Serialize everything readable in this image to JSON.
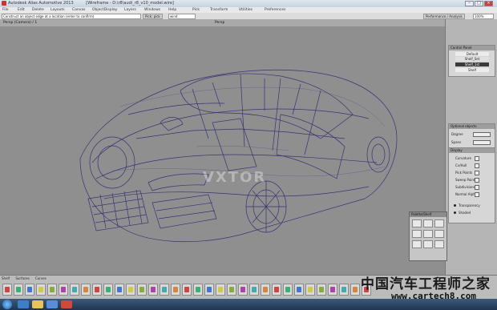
{
  "app": {
    "title": "Autodesk Alias Automotive 2013",
    "document": "[Wireframe - D:\\r8\\audi_r8_v10_model.wire]"
  },
  "window_controls": {
    "minimize": "–",
    "maximize": "□",
    "close": "×"
  },
  "menus": [
    "File",
    "Edit",
    "Delete",
    "Layouts",
    "Canvas",
    "ObjectDisplay",
    "Layers",
    "Windows",
    "Help",
    "Pick",
    "Transform",
    "Utilities",
    "Preferences"
  ],
  "toolbar": {
    "command_field": "Construct an object edge at a location (enter to confirm)",
    "mode_label": "Pick: pick",
    "mode_value": "wind",
    "right_field": "Performance / Analysis",
    "zoom": "100%"
  },
  "viewport": {
    "label": "Persp (Camera) / 1",
    "name": "Persp",
    "watermark_text": "VXTOR"
  },
  "right_panel": {
    "control_panel_title": "Control Panel",
    "rows": [
      "Default",
      "Shelf_Set",
      "Shelf_1st",
      "Shelf"
    ],
    "options_title": "Optional objects",
    "fields": [
      "Degree",
      "Spans"
    ],
    "display_title": "Display",
    "display_options": [
      "Curvature",
      "Cv/Hull",
      "Pick Points",
      "Sweep Points",
      "Subdivisions",
      "Normal Alpha"
    ],
    "radio_options": [
      "Transparency",
      "Shaded"
    ]
  },
  "palette": {
    "title": "Palette/Shelf"
  },
  "shelf": {
    "tabs": [
      "Shelf",
      "Surfaces",
      "Curves"
    ],
    "tool_count": 33
  },
  "taskbar": {
    "apps": [
      "Start",
      "IE",
      "Explorer",
      "Media",
      "Alias"
    ]
  },
  "overlay": {
    "chinese_watermark": "中国汽车工程师之家",
    "url": "www.cartech8.com"
  }
}
